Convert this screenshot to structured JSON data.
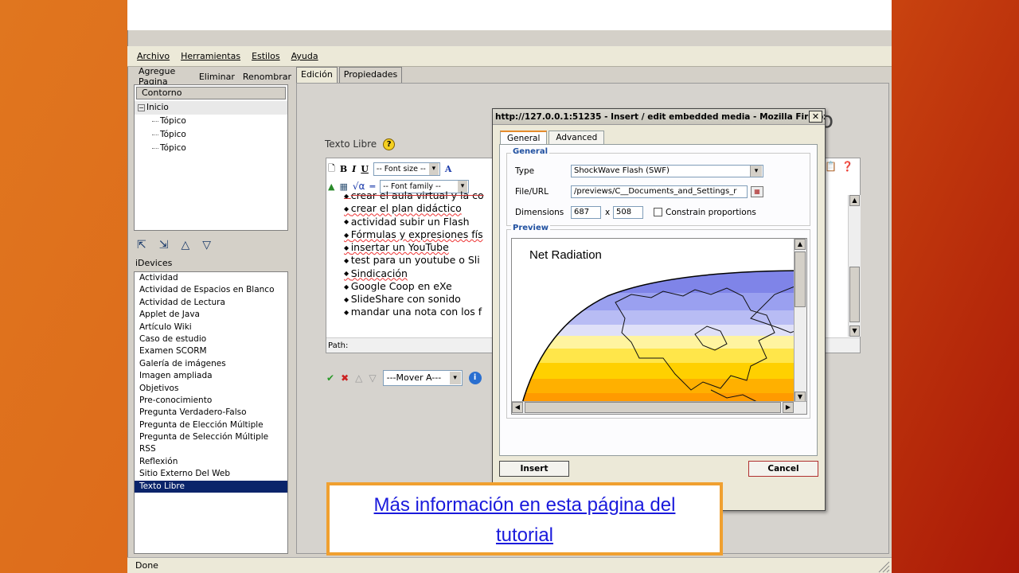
{
  "app": {
    "menu": [
      "Archivo",
      "Herramientas",
      "Estilos",
      "Ayuda"
    ],
    "left_toolbar": [
      "Agregue Pagina",
      "Eliminar",
      "Renombrar"
    ],
    "outline": {
      "header": "Contorno",
      "root": "Inicio",
      "children": [
        "Tópico",
        "Tópico",
        "Tópico"
      ]
    },
    "idevices_label": "iDevices",
    "idevices": [
      "Actividad",
      "Actividad de Espacios en Blanco",
      "Actividad de Lectura",
      "Applet de Java",
      "Artículo Wiki",
      "Caso de estudio",
      "Examen SCORM",
      "Galería de imágenes",
      "Imagen ampliada",
      "Objetivos",
      "Pre-conocimiento",
      "Pregunta Verdadero-Falso",
      "Pregunta de Elección Múltiple",
      "Pregunta de Selección Múltiple",
      "RSS",
      "Reflexión",
      "Sitio Externo Del Web",
      "Texto Libre"
    ],
    "idevices_selected": "Texto Libre",
    "tabs": [
      "Edición",
      "Propiedades"
    ],
    "active_tab": "Edición",
    "editor_title": "Texto Libre",
    "font_size_placeholder": "-- Font size --",
    "font_family_placeholder": "-- Font family --",
    "list_items": [
      {
        "text": "crear el aula virtual y la co",
        "struck": true
      },
      {
        "text": "crear el plan didáctico",
        "struck": true
      },
      {
        "text": "actividad subir un Flash",
        "struck": false
      },
      {
        "text": "Fórmulas y expresiones fís",
        "struck": false
      },
      {
        "text": "insertar un YouTube",
        "struck": false
      },
      {
        "text": "test para un youtube o Sli",
        "struck": false
      },
      {
        "text": "Sindicación",
        "struck": false
      },
      {
        "text": "Google Coop en eXe",
        "struck": false
      },
      {
        "text": "SlideShare con sonido",
        "struck": false
      },
      {
        "text": "mandar una nota con los f",
        "struck": false
      }
    ],
    "path_label": "Path:",
    "mover_select": "---Mover A---",
    "status": "Done"
  },
  "dialog": {
    "title": "http://127.0.0.1:51235 - Insert / edit embedded media - Mozilla Firefox",
    "tabs": [
      "General",
      "Advanced"
    ],
    "active_tab": "General",
    "general_legend": "General",
    "type_label": "Type",
    "type_value": "ShockWave Flash (SWF)",
    "file_label": "File/URL",
    "file_value": "/previews/C__Documents_and_Settings_r",
    "dimensions_label": "Dimensions",
    "width": "687",
    "times": "x",
    "height": "508",
    "constrain_label": "Constrain proportions",
    "preview_legend": "Preview",
    "preview_title": "Net Radiation",
    "insert_button": "Insert",
    "cancel_button": "Cancel"
  },
  "callout": {
    "line1": "Más información en esta página del",
    "line2": "tutorial"
  },
  "colors": {
    "selection": "#0a246a",
    "callout_border": "#f0a030",
    "link": "#1a1adc",
    "background_start": "#e0761f",
    "background_end": "#a91807"
  }
}
